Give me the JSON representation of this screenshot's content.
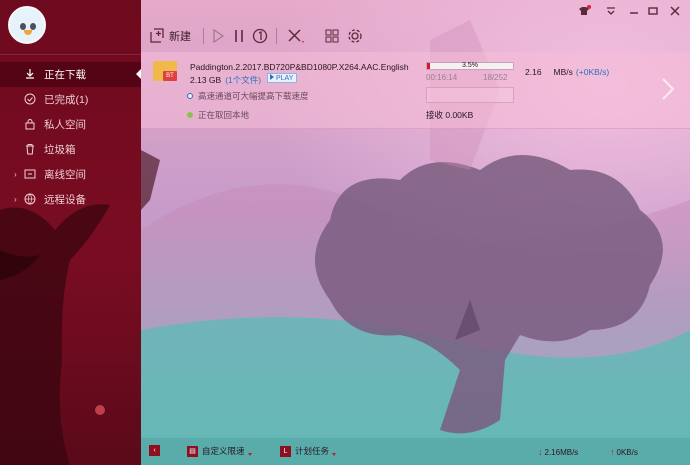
{
  "colors": {
    "sidebar_bg": "#6e0a1e",
    "accent_red": "#d4192f",
    "link_blue": "#2f6fbf",
    "status_green": "#8bc34a"
  },
  "user": {
    "name": ""
  },
  "sidebar": {
    "items": [
      {
        "label": "正在下载",
        "icon": "download-icon",
        "active": true,
        "expandable": false
      },
      {
        "label": "已完成(1)",
        "icon": "check-circle-icon",
        "active": false,
        "expandable": false
      },
      {
        "label": "私人空间",
        "icon": "private-space-icon",
        "active": false,
        "expandable": false
      },
      {
        "label": "垃圾箱",
        "icon": "trash-icon",
        "active": false,
        "expandable": false
      },
      {
        "label": "离线空间",
        "icon": "cloud-icon",
        "active": false,
        "expandable": true
      },
      {
        "label": "远程设备",
        "icon": "remote-device-icon",
        "active": false,
        "expandable": true
      }
    ]
  },
  "toolbar": {
    "new_label": "新建",
    "icons": [
      "new-task-icon",
      "play-icon",
      "pause-icon",
      "priority-icon",
      "delete-icon",
      "grid-view-icon",
      "settings-gear-icon"
    ]
  },
  "window_controls": [
    "skin-icon",
    "menu-icon",
    "minimize-icon",
    "maximize-icon",
    "close-icon"
  ],
  "task": {
    "name": "Paddington.2.2017.BD720P&BD1080P.X264.AAC.English",
    "file_tag": "BT",
    "size": "2.13 GB",
    "files": "(1个文件)",
    "play_label": "PLAY",
    "hint_accelerate": "高速通道可大幅提高下载速度",
    "hint_status": "正在取回本地",
    "progress_text": "3.5%",
    "progress": 0.035,
    "elapsed": "00:16:14",
    "pieces": "18/252",
    "speed_value": "2.16",
    "speed_unit": "MB/s",
    "upload_speed": "(+0KB/s)",
    "received": "接收 0.00KB"
  },
  "statusbar": {
    "collapse_icon": "collapse-left-icon",
    "custom_speed_label": "自定义限速",
    "schedule_label": "计划任务",
    "download_speed": "2.16MB/s",
    "upload_speed": "0KB/s"
  }
}
